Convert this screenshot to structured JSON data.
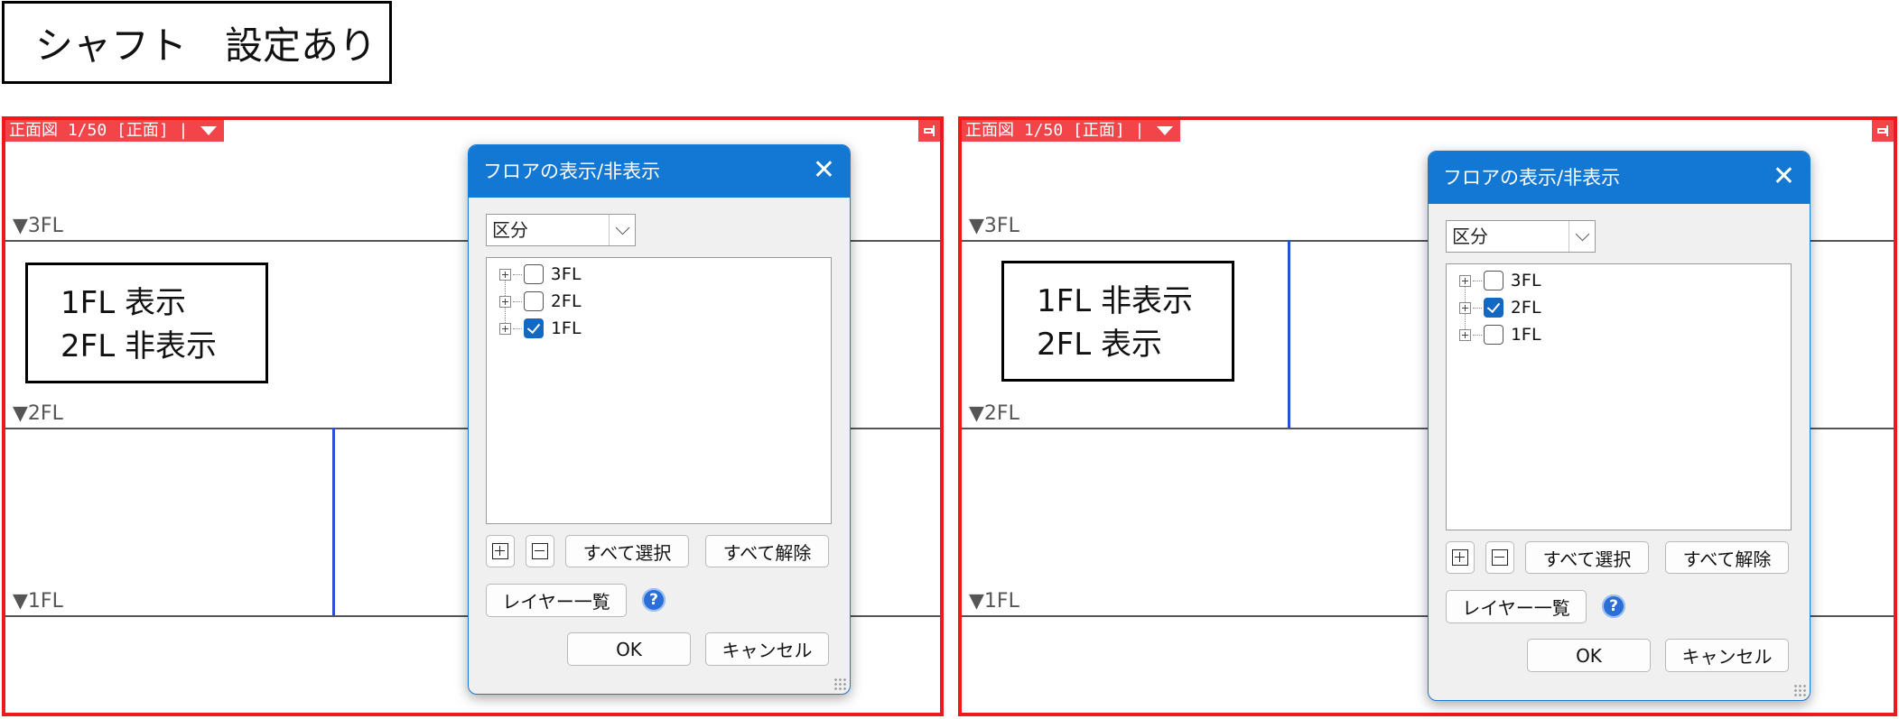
{
  "page_title": "シャフト　設定あり",
  "panels": [
    {
      "view_header": "正面図 1/50 [正面] |",
      "floors": [
        "▼3FL",
        "▼2FL",
        "▼1FL"
      ],
      "note": "1FL 表示\n2FL 非表示",
      "dialog": {
        "title": "フロアの表示/非表示",
        "close": "✕",
        "select_value": "区分",
        "tree": [
          {
            "label": "3FL",
            "checked": false
          },
          {
            "label": "2FL",
            "checked": false
          },
          {
            "label": "1FL",
            "checked": true
          }
        ],
        "select_all": "すべて選択",
        "clear_all": "すべて解除",
        "layer_list": "レイヤー一覧",
        "help": "?",
        "ok": "OK",
        "cancel": "キャンセル"
      }
    },
    {
      "view_header": "正面図 1/50 [正面] |",
      "floors": [
        "▼3FL",
        "▼2FL",
        "▼1FL"
      ],
      "note": "1FL 非表示\n2FL 表示",
      "dialog": {
        "title": "フロアの表示/非表示",
        "close": "✕",
        "select_value": "区分",
        "tree": [
          {
            "label": "3FL",
            "checked": false
          },
          {
            "label": "2FL",
            "checked": true
          },
          {
            "label": "1FL",
            "checked": false
          }
        ],
        "select_all": "すべて選択",
        "clear_all": "すべて解除",
        "layer_list": "レイヤー一覧",
        "help": "?",
        "ok": "OK",
        "cancel": "キャンセル"
      }
    }
  ],
  "colors": {
    "frame": "#ee1a1a",
    "header": "#f3444a",
    "titlebar": "#1378d4",
    "shaft": "#2a4fd4"
  }
}
